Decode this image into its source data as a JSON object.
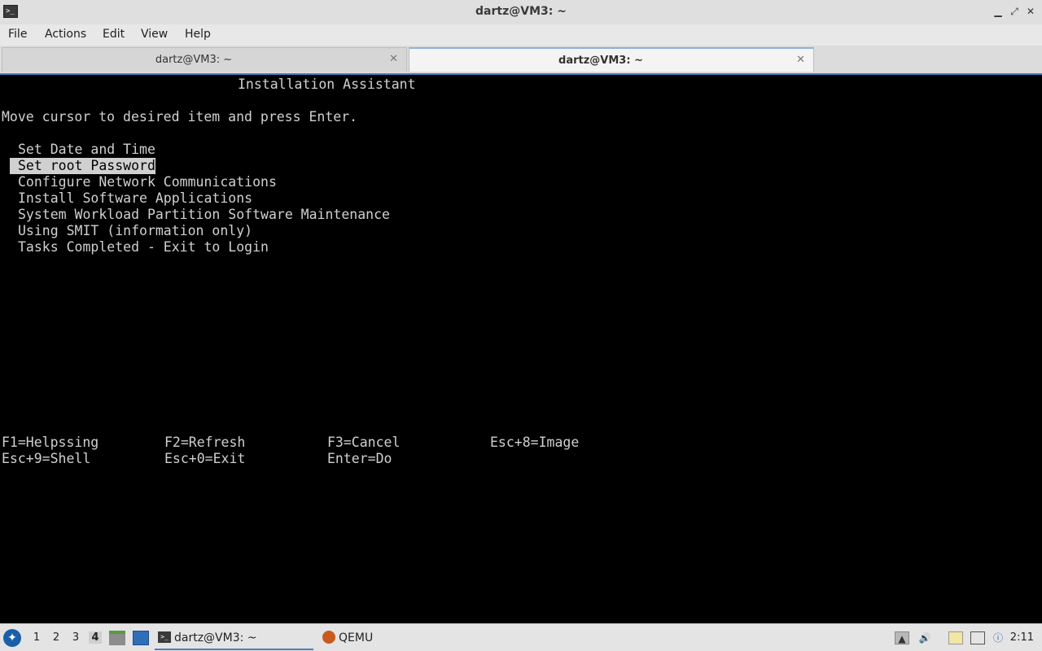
{
  "window": {
    "title": "dartz@VM3: ~",
    "icon": "terminal-icon"
  },
  "menubar": {
    "items": [
      "File",
      "Actions",
      "Edit",
      "View",
      "Help"
    ]
  },
  "tabs": [
    {
      "label": "dartz@VM3: ~",
      "active": false
    },
    {
      "label": "dartz@VM3: ~",
      "active": true
    }
  ],
  "terminal": {
    "heading": "Installation Assistant",
    "instruction": "Move cursor to desired item and press Enter.",
    "menu_items": [
      "Set Date and Time",
      "Set root Password",
      "Configure Network Communications",
      "Install Software Applications",
      "System Workload Partition Software Maintenance",
      "Using SMIT (information only)",
      "Tasks Completed - Exit to Login"
    ],
    "selected_item": "Set root Password",
    "function_keys": [
      [
        "F1=Helpssing",
        "F2=Refresh",
        "F3=Cancel",
        "Esc+8=Image"
      ],
      [
        "Esc+9=Shell",
        "Esc+0=Exit",
        "Enter=Do"
      ]
    ],
    "colors": {
      "background": "#000000",
      "foreground": "#d0d0d0",
      "highlight": "#d0d0d0"
    }
  },
  "taskbar": {
    "desktops": [
      "1",
      "2",
      "3",
      "4"
    ],
    "current_desktop": "4",
    "tasks": [
      {
        "label": "dartz@VM3: ~",
        "icon": "terminal-icon",
        "active": true
      },
      {
        "label": "QEMU",
        "icon": "qemu-icon",
        "active": false
      }
    ],
    "clock": "2:11"
  }
}
